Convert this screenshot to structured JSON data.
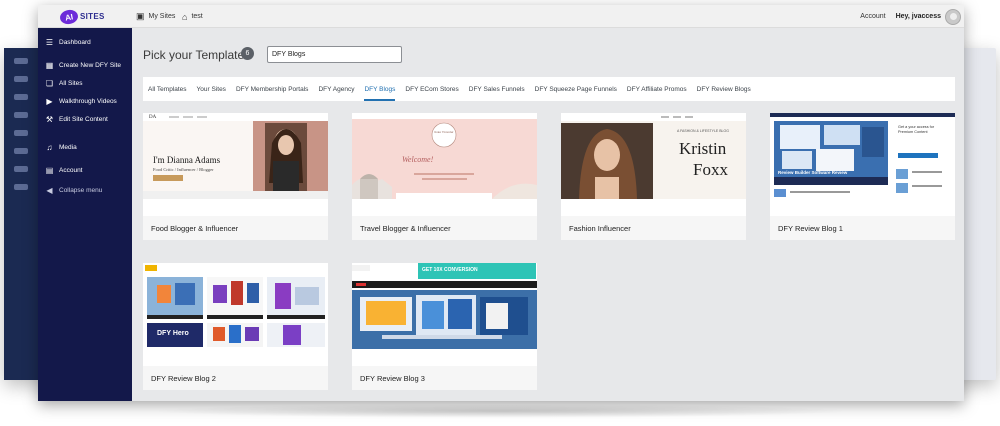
{
  "topbar": {
    "logo_badge": "AI",
    "logo_text": "SITES",
    "my_sites": "My Sites",
    "site_name": "test",
    "account": "Account",
    "greeting": "Hey, jvaccess"
  },
  "sidebar": {
    "items": [
      {
        "label": "Dashboard",
        "icon": "menu-icon"
      },
      {
        "label": "Create New DFY Site",
        "icon": "table-icon"
      },
      {
        "label": "All Sites",
        "icon": "pages-icon"
      },
      {
        "label": "Walkthrough Videos",
        "icon": "play-icon"
      },
      {
        "label": "Edit Site Content",
        "icon": "wrench-icon"
      },
      {
        "label": "Media",
        "icon": "media-icon"
      },
      {
        "label": "Account",
        "icon": "id-card-icon"
      },
      {
        "label": "Collapse menu",
        "icon": "collapse-icon"
      }
    ]
  },
  "main": {
    "title": "Pick your Template",
    "count": "6",
    "search_value": "DFY Blogs",
    "tabs": [
      {
        "label": "All Templates",
        "active": false
      },
      {
        "label": "Your Sites",
        "active": false
      },
      {
        "label": "DFY Membership Portals",
        "active": false
      },
      {
        "label": "DFY Agency",
        "active": false
      },
      {
        "label": "DFY Blogs",
        "active": true
      },
      {
        "label": "DFY ECom Stores",
        "active": false
      },
      {
        "label": "DFY Sales Funnels",
        "active": false
      },
      {
        "label": "DFY Squeeze Page Funnels",
        "active": false
      },
      {
        "label": "DFY Affiliate Promos",
        "active": false
      },
      {
        "label": "DFY Review Blogs",
        "active": false
      }
    ],
    "templates": [
      {
        "name": "Food Blogger & Influencer",
        "thumb_title": "I'm Dianna Adams",
        "thumb_sub": "Food Critic / Influencer / Blogger",
        "thumb_logo": "DA"
      },
      {
        "name": "Travel Blogger & Influencer",
        "thumb_title": "Welcome!",
        "thumb_logo": "Kate Traveler"
      },
      {
        "name": "Fashion Influencer",
        "thumb_title": "Kristin",
        "thumb_title2": "Foxx",
        "thumb_tag": "A FASHION & LIFESTYLE BLOG"
      },
      {
        "name": "DFY Review Blog 1",
        "thumb_title": "Get a your access for Premium Content",
        "thumb_caption": "Review Builder Software Review"
      },
      {
        "name": "DFY Review Blog 2",
        "thumb_caption": "DFY Hero"
      },
      {
        "name": "DFY Review Blog 3",
        "thumb_banner": "GET 10X CONVERSION"
      }
    ]
  },
  "colors": {
    "sidebar_bg": "#13184a",
    "accent": "#2271b1",
    "window_bg": "#e7e8ea"
  }
}
